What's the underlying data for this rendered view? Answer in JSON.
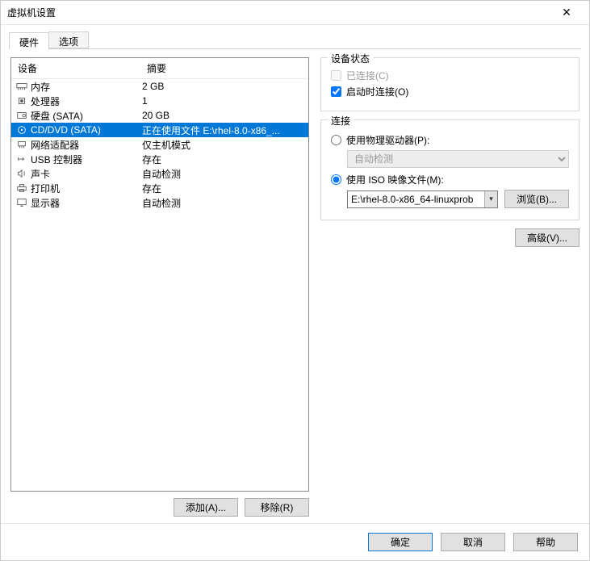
{
  "title": "虚拟机设置",
  "tabs": {
    "hardware": "硬件",
    "options": "选项"
  },
  "list": {
    "hdr_device": "设备",
    "hdr_summary": "摘要",
    "rows": [
      {
        "icon": "memory-icon",
        "device": "内存",
        "summary": "2 GB"
      },
      {
        "icon": "cpu-icon",
        "device": "处理器",
        "summary": "1"
      },
      {
        "icon": "disk-icon",
        "device": "硬盘 (SATA)",
        "summary": "20 GB"
      },
      {
        "icon": "cd-icon",
        "device": "CD/DVD (SATA)",
        "summary": "正在使用文件 E:\\rhel-8.0-x86_..."
      },
      {
        "icon": "nic-icon",
        "device": "网络适配器",
        "summary": "仅主机模式"
      },
      {
        "icon": "usb-icon",
        "device": "USB 控制器",
        "summary": "存在"
      },
      {
        "icon": "sound-icon",
        "device": "声卡",
        "summary": "自动检测"
      },
      {
        "icon": "printer-icon",
        "device": "打印机",
        "summary": "存在"
      },
      {
        "icon": "display-icon",
        "device": "显示器",
        "summary": "自动检测"
      }
    ],
    "selected": 3,
    "add": "添加(A)...",
    "remove": "移除(R)"
  },
  "status": {
    "legend": "设备状态",
    "connected": "已连接(C)",
    "connect_at_poweron": "启动时连接(O)"
  },
  "conn": {
    "legend": "连接",
    "physical": "使用物理驱动器(P):",
    "autodetect": "自动检测",
    "iso": "使用 ISO 映像文件(M):",
    "iso_path": "E:\\rhel-8.0-x86_64-linuxprob",
    "browse": "浏览(B)..."
  },
  "advanced": "高级(V)...",
  "footer": {
    "ok": "确定",
    "cancel": "取消",
    "help": "帮助"
  }
}
